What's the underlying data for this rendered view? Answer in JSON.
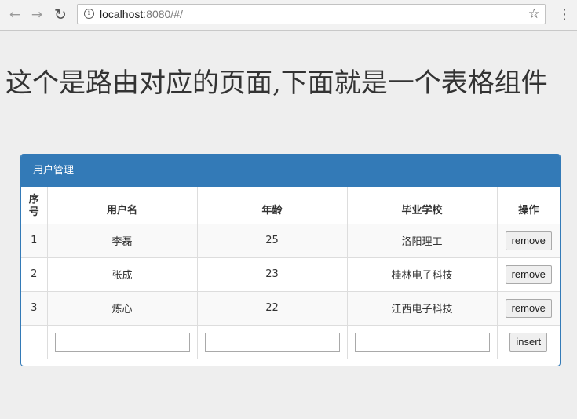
{
  "browser": {
    "url_host": "localhost",
    "url_path": ":8080/#/"
  },
  "page": {
    "title": "这个是路由对应的页面,下面就是一个表格组件"
  },
  "panel": {
    "heading": "用户管理",
    "columns": [
      "序号",
      "用户名",
      "年龄",
      "毕业学校",
      "操作"
    ],
    "rows": [
      {
        "index": "1",
        "name": "李磊",
        "age": "25",
        "school": "洛阳理工",
        "action": "remove"
      },
      {
        "index": "2",
        "name": "张成",
        "age": "23",
        "school": "桂林电子科技",
        "action": "remove"
      },
      {
        "index": "3",
        "name": "炼心",
        "age": "22",
        "school": "江西电子科技",
        "action": "remove"
      }
    ],
    "input_row": {
      "name_value": "",
      "age_value": "",
      "school_value": "",
      "insert_label": "insert"
    }
  }
}
